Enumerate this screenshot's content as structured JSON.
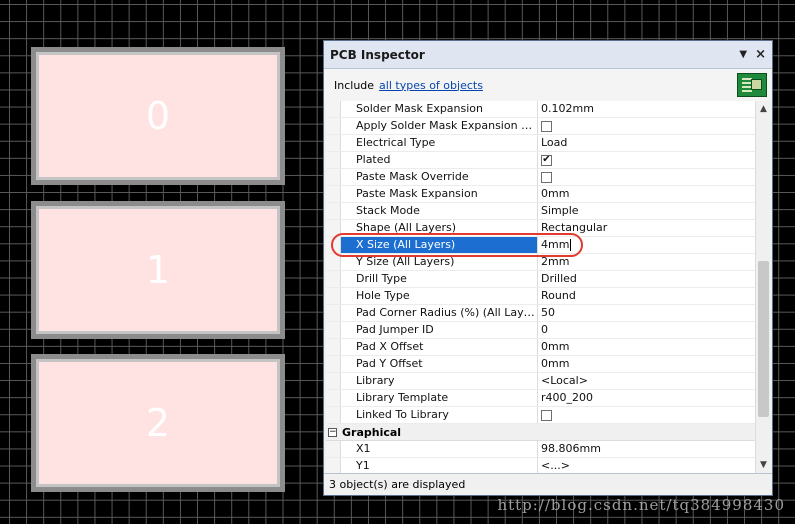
{
  "pads": [
    {
      "label": "0"
    },
    {
      "label": "1"
    },
    {
      "label": "2"
    }
  ],
  "inspector": {
    "title": "PCB Inspector",
    "include_label": "Include",
    "include_link": "all types of objects",
    "properties": [
      {
        "name": "Solder Mask Expansion",
        "value": "0.102mm",
        "type": "text"
      },
      {
        "name": "Apply Solder Mask Expansion Fr...",
        "value": "",
        "type": "checkbox",
        "checked": false
      },
      {
        "name": "Electrical Type",
        "value": "Load",
        "type": "text"
      },
      {
        "name": "Plated",
        "value": "",
        "type": "checkbox",
        "checked": true
      },
      {
        "name": "Paste Mask Override",
        "value": "",
        "type": "checkbox",
        "checked": false
      },
      {
        "name": "Paste Mask Expansion",
        "value": "0mm",
        "type": "text"
      },
      {
        "name": "Stack Mode",
        "value": "Simple",
        "type": "text"
      },
      {
        "name": "Shape (All Layers)",
        "value": "Rectangular",
        "type": "text"
      },
      {
        "name": "X Size (All Layers)",
        "value": "4mm",
        "type": "text",
        "selected": true
      },
      {
        "name": "Y Size (All Layers)",
        "value": "2mm",
        "type": "text"
      },
      {
        "name": "Drill Type",
        "value": "Drilled",
        "type": "text"
      },
      {
        "name": "Hole Type",
        "value": "Round",
        "type": "text"
      },
      {
        "name": "Pad Corner Radius (%) (All Layers)",
        "value": "50",
        "type": "text"
      },
      {
        "name": "Pad Jumper ID",
        "value": "0",
        "type": "text"
      },
      {
        "name": "Pad X Offset",
        "value": "0mm",
        "type": "text"
      },
      {
        "name": "Pad Y Offset",
        "value": "0mm",
        "type": "text"
      },
      {
        "name": "Library",
        "value": "<Local>",
        "type": "text"
      },
      {
        "name": "Library Template",
        "value": "r400_200",
        "type": "text"
      },
      {
        "name": "Linked To Library",
        "value": "",
        "type": "checkbox",
        "checked": false
      }
    ],
    "section": {
      "toggle": "−",
      "title": "Graphical"
    },
    "graphical": [
      {
        "name": "X1",
        "value": "98.806mm"
      },
      {
        "name": "Y1",
        "value": "<...>"
      }
    ],
    "status": "3 object(s) are displayed"
  },
  "watermark": "http://blog.csdn.net/tq384998430",
  "colors": {
    "selection": "#1c6fd1",
    "pad_fill": "#ffe2e2",
    "annotation": "#e23a2e"
  }
}
